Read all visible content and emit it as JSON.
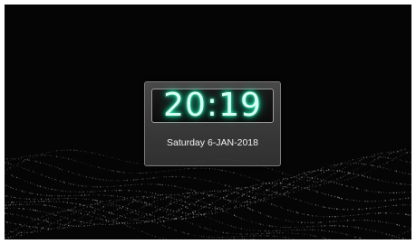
{
  "clock": {
    "time": "20:19",
    "date": "Saturday 6-JAN-2018"
  }
}
